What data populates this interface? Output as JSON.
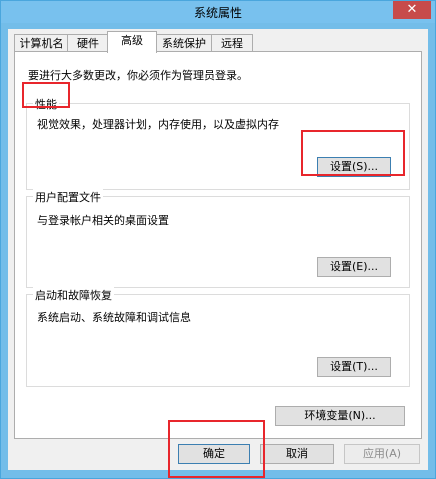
{
  "window": {
    "title": "系统属性",
    "close_glyph": "✕"
  },
  "tabs": [
    {
      "label": "计算机名"
    },
    {
      "label": "硬件"
    },
    {
      "label": "高级"
    },
    {
      "label": "系统保护"
    },
    {
      "label": "远程"
    }
  ],
  "advanced": {
    "admin_note": "要进行大多数更改，你必须作为管理员登录。",
    "performance": {
      "title": "性能",
      "description": "视觉效果，处理器计划，内存使用，以及虚拟内存",
      "button": "设置(S)..."
    },
    "user_profiles": {
      "title": "用户配置文件",
      "description": "与登录帐户相关的桌面设置",
      "button": "设置(E)..."
    },
    "startup_recovery": {
      "title": "启动和故障恢复",
      "description": "系统启动、系统故障和调试信息",
      "button": "设置(T)..."
    },
    "env_button": "环境变量(N)..."
  },
  "footer": {
    "ok": "确定",
    "cancel": "取消",
    "apply": "应用(A)"
  },
  "highlight_color": "#e8262c"
}
